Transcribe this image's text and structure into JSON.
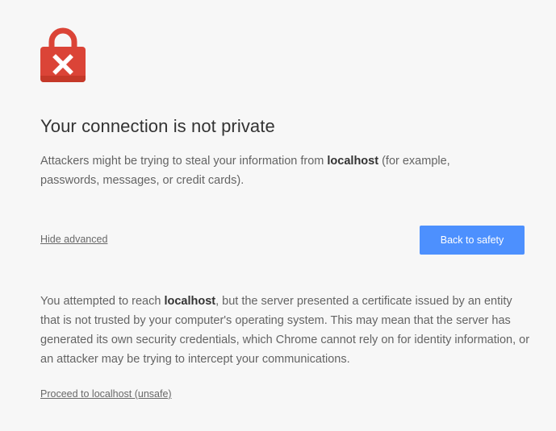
{
  "interstitial": {
    "icon": "lock-error-icon",
    "title": "Your connection is not private",
    "lead": {
      "before": "Attackers might be trying to steal your information from ",
      "host": "localhost",
      "after": " (for example, passwords, messages, or credit cards)."
    },
    "hide_advanced_label": "Hide advanced",
    "back_to_safety_label": "Back to safety",
    "details": {
      "before": "You attempted to reach ",
      "host": "localhost",
      "after": ", but the server presented a certificate issued by an entity that is not trusted by your computer's operating system. This may mean that the server has generated its own security credentials, which Chrome cannot rely on for identity information, or an attacker may be trying to intercept your communications."
    },
    "proceed_label": "Proceed to localhost (unsafe)"
  },
  "colors": {
    "background": "#f7f7f7",
    "lock_red": "#db4437",
    "button_blue": "#4d90fe",
    "title_text": "#333333",
    "body_text": "#646464"
  }
}
